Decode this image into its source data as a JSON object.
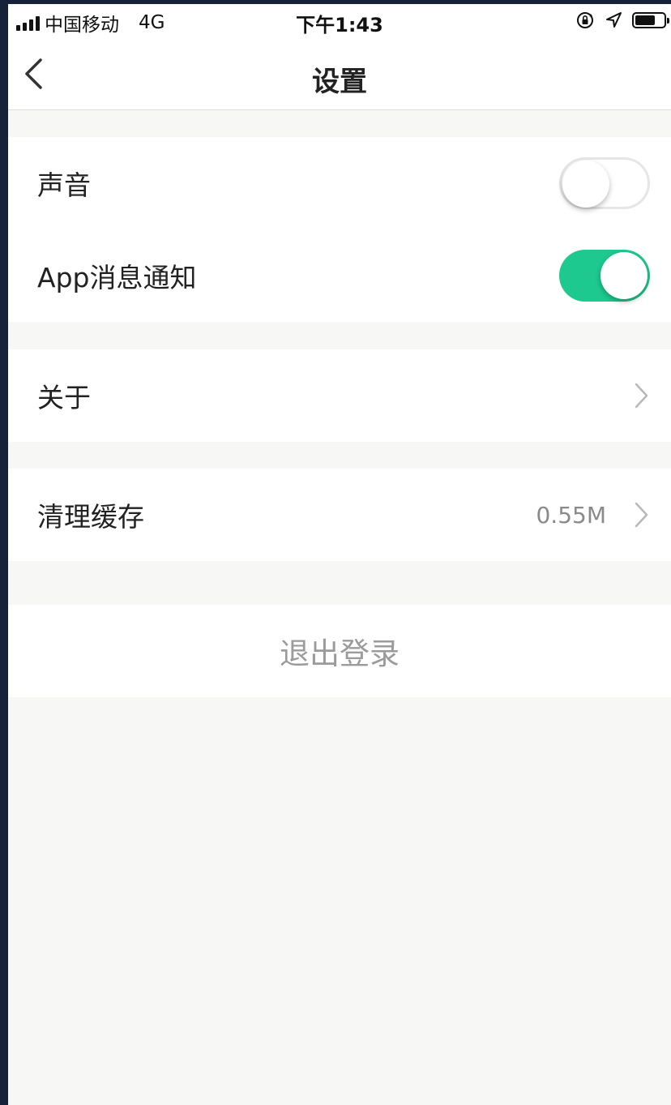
{
  "status_bar": {
    "carrier": "中国移动",
    "network": "4G",
    "time": "下午1:43",
    "icons": [
      "signal-icon",
      "orientation-lock-icon",
      "location-arrow-icon",
      "battery-icon"
    ],
    "battery_level": 0.6
  },
  "nav": {
    "title": "设置",
    "back_icon": "chevron-left-icon"
  },
  "settings": {
    "sound": {
      "label": "声音",
      "enabled": false
    },
    "app_notification": {
      "label": "App消息通知",
      "enabled": true
    },
    "about": {
      "label": "关于",
      "icon": "chevron-right-icon"
    },
    "clear_cache": {
      "label": "清理缓存",
      "value": "0.55M",
      "icon": "chevron-right-icon"
    },
    "logout": {
      "label": "退出登录"
    }
  },
  "colors": {
    "accent": "#1dc98f",
    "page_background": "#f7f7f5",
    "muted_text": "#9b9b9b"
  }
}
